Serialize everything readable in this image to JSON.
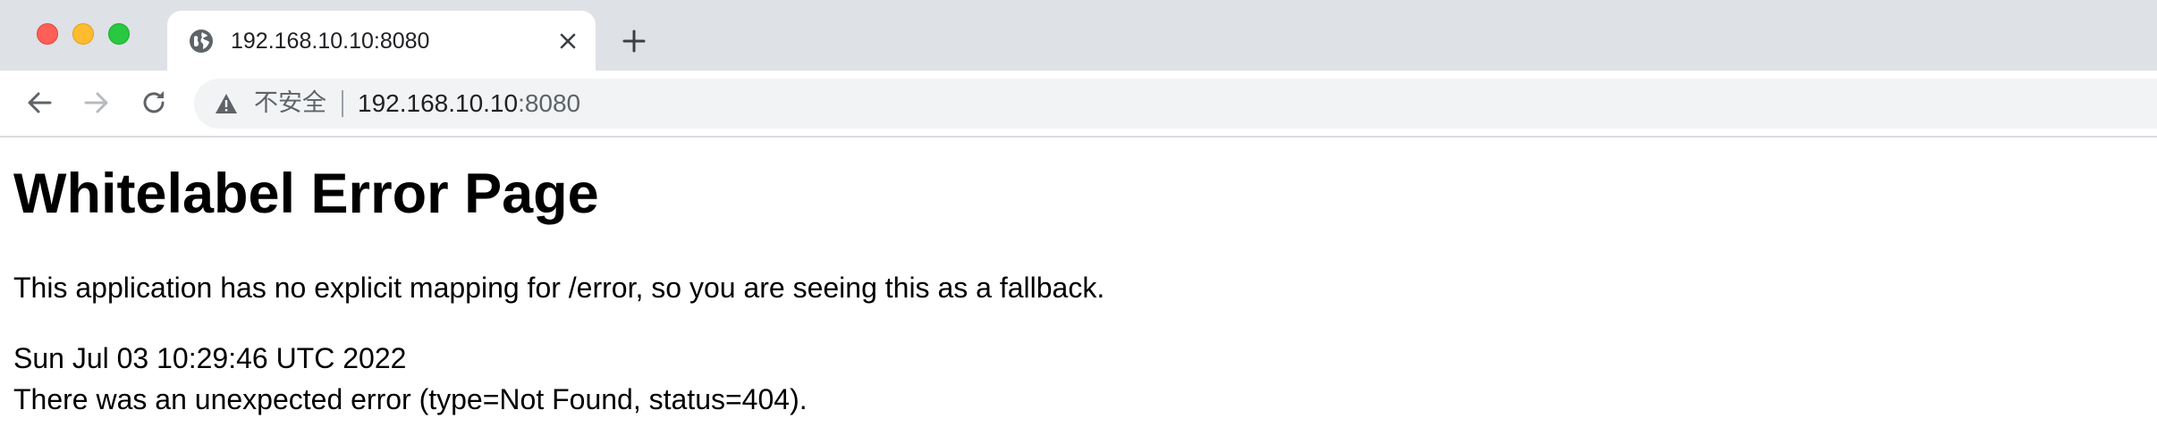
{
  "tab": {
    "title": "192.168.10.10:8080",
    "icon": "globe-icon"
  },
  "toolbar": {
    "security_label": "不安全",
    "url_host": "192.168.10.10",
    "url_port": ":8080"
  },
  "page": {
    "heading": "Whitelabel Error Page",
    "description": "This application has no explicit mapping for /error, so you are seeing this as a fallback.",
    "timestamp": "Sun Jul 03 10:29:46 UTC 2022",
    "error_detail": "There was an unexpected error (type=Not Found, status=404)."
  },
  "colors": {
    "tabstrip": "#dee1e6",
    "omnibox": "#f1f3f4",
    "close": "#ff5f57",
    "minimize": "#febc2e",
    "maximize": "#28c840"
  }
}
